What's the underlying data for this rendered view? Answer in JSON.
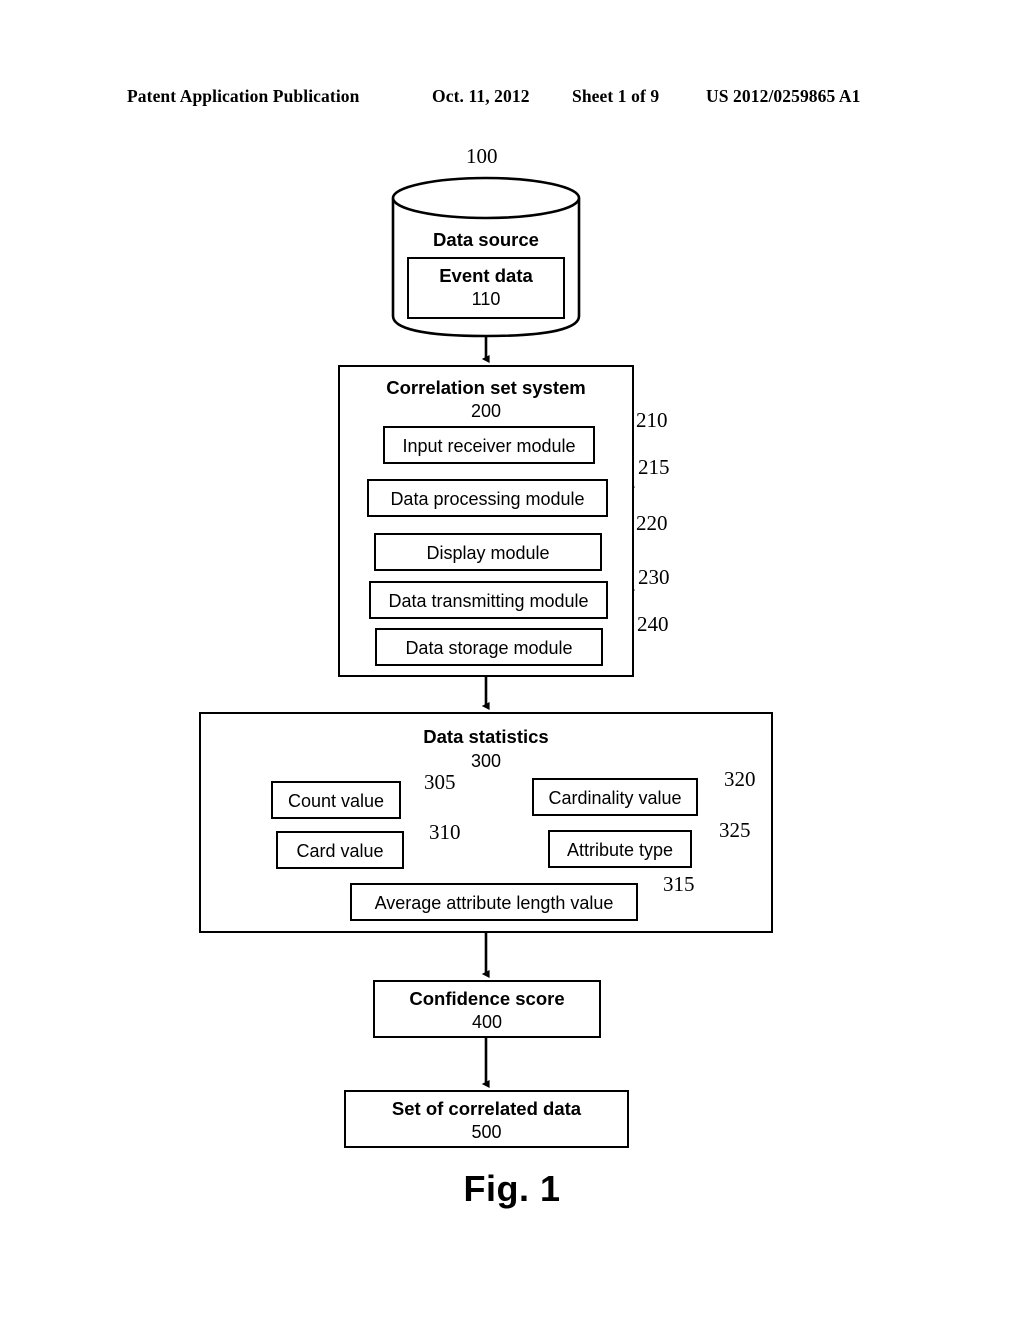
{
  "header": {
    "publication": "Patent Application Publication",
    "date": "Oct. 11, 2012",
    "sheet": "Sheet 1 of 9",
    "patent_number": "US 2012/0259865 A1"
  },
  "figure": {
    "caption": "Fig. 1"
  },
  "data_source": {
    "ref": "100",
    "title": "Data source",
    "event_data": {
      "title": "Event data",
      "ref": "110"
    }
  },
  "correlation_system": {
    "title": "Correlation set system",
    "ref": "200",
    "modules": [
      {
        "label": "Input receiver module",
        "ref": "210"
      },
      {
        "label": "Data processing module",
        "ref": "215"
      },
      {
        "label": "Display module",
        "ref": "220"
      },
      {
        "label": "Data transmitting module",
        "ref": "230"
      },
      {
        "label": "Data storage module",
        "ref": "240"
      }
    ]
  },
  "data_statistics": {
    "title": "Data statistics",
    "ref": "300",
    "items": [
      {
        "label": "Count value",
        "ref": "305"
      },
      {
        "label": "Card value",
        "ref": "310"
      },
      {
        "label": "Cardinality value",
        "ref": "320"
      },
      {
        "label": "Attribute type",
        "ref": "325"
      },
      {
        "label": "Average attribute length value",
        "ref": "315"
      }
    ]
  },
  "confidence_score": {
    "title": "Confidence score",
    "ref": "400"
  },
  "correlated_data": {
    "title": "Set of correlated data",
    "ref": "500"
  },
  "colors": {
    "stroke": "#000000",
    "background": "#ffffff"
  }
}
